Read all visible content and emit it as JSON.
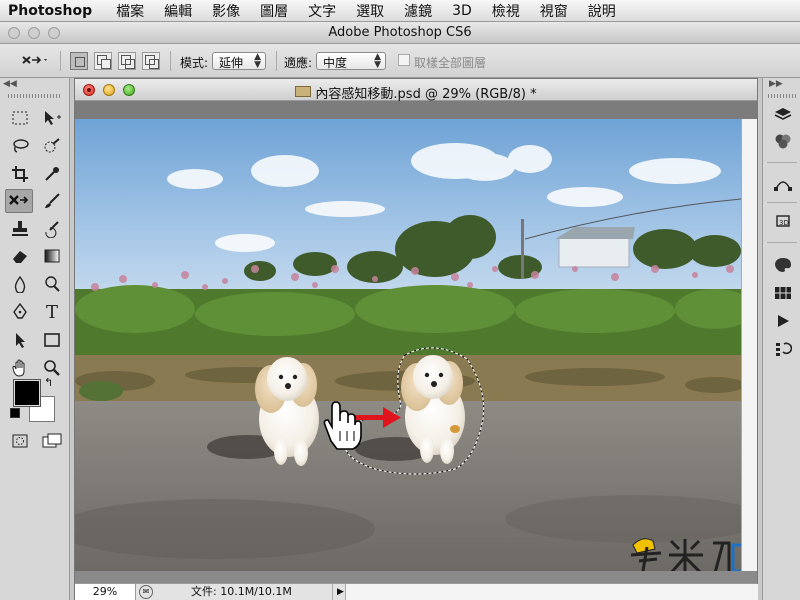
{
  "menubar": {
    "app": "Photoshop",
    "items": [
      "檔案",
      "編輯",
      "影像",
      "圖層",
      "文字",
      "選取",
      "濾鏡",
      "3D",
      "檢視",
      "視窗",
      "說明"
    ]
  },
  "app_title": "Adobe Photoshop CS6",
  "options": {
    "mode_label": "模式:",
    "mode_value": "延伸",
    "adapt_label": "適應:",
    "adapt_value": "中度",
    "sample_all_label": "取樣全部圖層"
  },
  "document": {
    "title": "內容感知移動.psd @ 29% (RGB/8) *",
    "zoom": "29%",
    "doc_info": "文件: 10.1M/10.1M",
    "watermark": "奧米加"
  },
  "tools": {
    "left": [
      "rect-marquee-icon",
      "move-icon",
      "lasso-icon",
      "quick-select-icon",
      "crop-icon",
      "eyedropper-icon",
      "content-aware-move-icon",
      "brush-icon",
      "stamp-icon",
      "history-brush-icon",
      "eraser-icon",
      "gradient-icon",
      "blur-icon",
      "dodge-icon",
      "pen-icon",
      "type-icon",
      "path-select-icon",
      "shape-icon",
      "hand-icon",
      "zoom-icon"
    ]
  },
  "colors": {
    "foreground": "#000000",
    "background": "#ffffff",
    "arrow": "#e0141c"
  }
}
